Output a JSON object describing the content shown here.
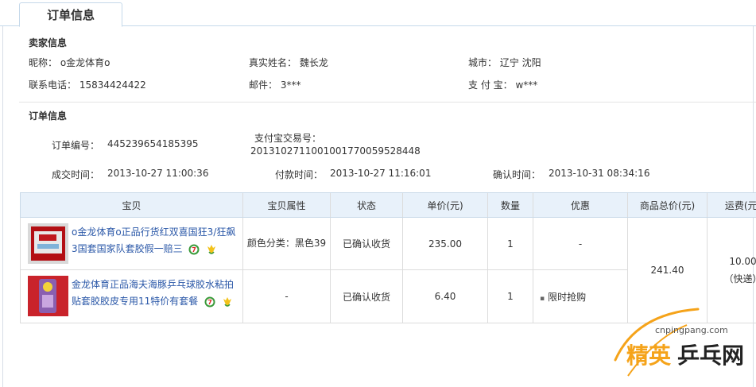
{
  "tab": {
    "label": "订单信息"
  },
  "seller": {
    "title": "卖家信息",
    "nickname": "昵称：  o金龙体育o",
    "realname": "真实姓名：  魏长龙",
    "city": "城市：  辽宁 沈阳",
    "phone": "联系电话：  15834424422",
    "email": "邮件：  3***",
    "alipay": "支 付 宝：  w***"
  },
  "order": {
    "title": "订单信息",
    "order_no_label": "订单编号：",
    "order_no": "445239654185395",
    "alipay_no_label": "支付宝交易号：",
    "alipay_no": "2013102711001001770059528448",
    "deal_time_label": "成交时间：",
    "deal_time": "2013-10-27 11:00:36",
    "pay_time_label": "付款时间：",
    "pay_time": "2013-10-27 11:16:01",
    "confirm_time_label": "确认时间：",
    "confirm_time": "2013-10-31 08:34:16"
  },
  "table": {
    "headers": [
      "宝贝",
      "宝贝属性",
      "状态",
      "单价(元)",
      "数量",
      "优惠",
      "商品总价(元)",
      "运费(元)"
    ],
    "rows": [
      {
        "title": "o金龙体育o正品行货红双喜国狂3/狂飙3国套国家队套胶假一赔三",
        "attr": "颜色分类：黑色39",
        "status": "已确认收货",
        "price": "235.00",
        "qty": "1",
        "discount": "-"
      },
      {
        "title": "金龙体育正品海夫海豚乒乓球胶水粘拍贴套胶胶皮专用11特价有套餐",
        "attr": "-",
        "status": "已确认收货",
        "price": "6.40",
        "qty": "1",
        "discount": "限时抢购"
      }
    ],
    "total": "241.40",
    "shipping": "10.00",
    "shipping_method": "（快递）"
  },
  "watermark": {
    "url": "cnpingpang.com",
    "brand": "精英乒乓网"
  },
  "colors": {
    "link": "#2b58a8",
    "header_bg": "#e8f1fa",
    "border": "#c5d9ea",
    "logo_orange": "#f5a31a"
  }
}
